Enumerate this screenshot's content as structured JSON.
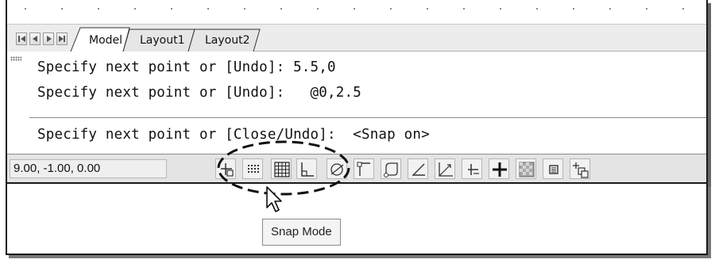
{
  "tabs": {
    "items": [
      {
        "label": "Model",
        "active": true
      },
      {
        "label": "Layout1",
        "active": false
      },
      {
        "label": "Layout2",
        "active": false
      }
    ]
  },
  "command": {
    "lines": [
      "Specify next point or [Undo]: 5.5,0",
      "Specify next point or [Undo]:   @0,2.5",
      "Specify next point or [Close/Undo]:  <Snap on>"
    ]
  },
  "status": {
    "coordinates": "9.00, -1.00, 0.00",
    "toggles": [
      {
        "name": "infer-constraints",
        "icon": "infer-constraints-icon"
      },
      {
        "name": "snap-mode",
        "icon": "snap-dots-icon"
      },
      {
        "name": "grid-display",
        "icon": "grid-icon"
      },
      {
        "name": "ortho-mode",
        "icon": "ortho-icon"
      },
      {
        "name": "polar-tracking",
        "icon": "polar-icon"
      },
      {
        "name": "object-snap",
        "icon": "osnap-icon"
      },
      {
        "name": "3d-object-snap",
        "icon": "3d-osnap-icon"
      },
      {
        "name": "object-snap-tracking",
        "icon": "otrack-icon"
      },
      {
        "name": "dynamic-ucs",
        "icon": "ducs-icon"
      },
      {
        "name": "dynamic-input",
        "icon": "dynamic-input-icon"
      },
      {
        "name": "lineweight",
        "icon": "lineweight-icon"
      },
      {
        "name": "show-hide-transparency",
        "icon": "transparency-icon"
      },
      {
        "name": "quick-properties",
        "icon": "quick-properties-icon"
      },
      {
        "name": "selection-cycling",
        "icon": "selection-cycling-icon"
      }
    ]
  },
  "tooltip": {
    "text": "Snap Mode"
  },
  "colors": {
    "highlight_ellipse": "#111111",
    "status_bar": "#e4e4e4",
    "tab_bar": "#ececec"
  }
}
